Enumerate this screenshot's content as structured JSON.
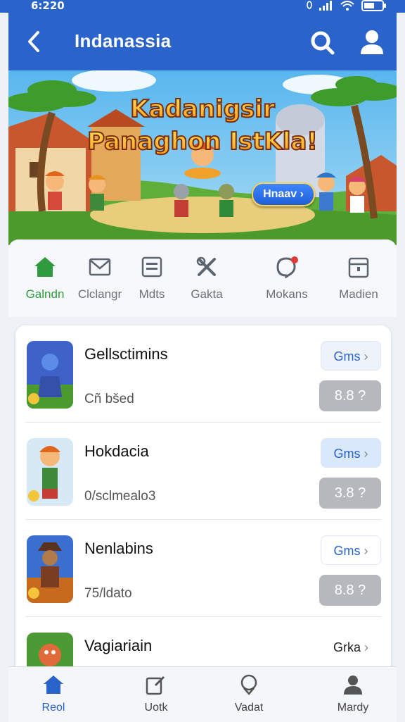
{
  "status_bar": {
    "time": "6:220"
  },
  "app_bar": {
    "title": "Indanassia"
  },
  "banner": {
    "title_line1": "Kadanigsir",
    "title_line2": "Panaghon IstKla!",
    "button_label": "Hnaav ›"
  },
  "categories": [
    {
      "label": "Galndn",
      "icon": "home-icon",
      "active": true
    },
    {
      "label": "Clclangr",
      "icon": "mail-icon"
    },
    {
      "label": "Mdts",
      "icon": "printer-icon"
    },
    {
      "label": "Gakta",
      "icon": "tools-icon"
    },
    {
      "label": "Mokans",
      "icon": "notification-icon"
    },
    {
      "label": "Madien",
      "icon": "calendar-icon"
    }
  ],
  "games": [
    {
      "name": "Gellsctimins",
      "subtitle": "Cñ bšed",
      "button": "Gms",
      "rating": "8.8 ?"
    },
    {
      "name": "Hokdacia",
      "subtitle": "0/sclmealo3",
      "button": "Gms",
      "rating": "3.8 ?"
    },
    {
      "name": "Nenlabins",
      "subtitle": "75/ldato",
      "button": "Gms",
      "rating": "8.8 ?"
    },
    {
      "name": "Vagiariain",
      "subtitle": "",
      "button": "Grka",
      "rating": ""
    }
  ],
  "tabs": [
    {
      "label": "Reol",
      "icon": "home-icon",
      "active": true
    },
    {
      "label": "Uotk",
      "icon": "edit-icon"
    },
    {
      "label": "Vadat",
      "icon": "location-icon"
    },
    {
      "label": "Mardy",
      "icon": "profile-icon"
    }
  ],
  "colors": {
    "primary": "#2a63c9",
    "active_green": "#2e9a3c",
    "rating_bg": "#b6b8bd"
  }
}
